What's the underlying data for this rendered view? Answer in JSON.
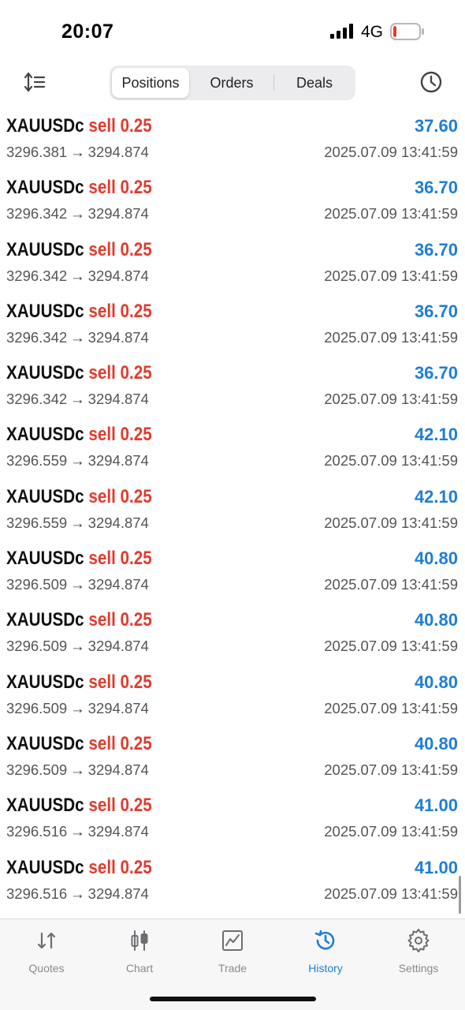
{
  "status_bar": {
    "time": "20:07",
    "network": "4G",
    "signal_icon": "signal-bars-icon",
    "battery_icon": "battery-low-icon",
    "battery_level": 0.12,
    "battery_color": "#e23b2e"
  },
  "header": {
    "sort_icon": "sort-icon",
    "history_icon": "clock-icon",
    "tabs": [
      {
        "label": "Positions",
        "active": true
      },
      {
        "label": "Orders",
        "active": false
      },
      {
        "label": "Deals",
        "active": false
      }
    ]
  },
  "colors": {
    "accent": "#1e7ed6",
    "sell": "#e23b2e",
    "profit": "#1e7ed6"
  },
  "deals": [
    {
      "symbol": "XAUUSDc",
      "side": "sell",
      "volume": "0.25",
      "open_price": "3296.381",
      "close_price": "3294.874",
      "profit": "37.60",
      "time": "2025.07.09 13:41:59"
    },
    {
      "symbol": "XAUUSDc",
      "side": "sell",
      "volume": "0.25",
      "open_price": "3296.342",
      "close_price": "3294.874",
      "profit": "36.70",
      "time": "2025.07.09 13:41:59"
    },
    {
      "symbol": "XAUUSDc",
      "side": "sell",
      "volume": "0.25",
      "open_price": "3296.342",
      "close_price": "3294.874",
      "profit": "36.70",
      "time": "2025.07.09 13:41:59"
    },
    {
      "symbol": "XAUUSDc",
      "side": "sell",
      "volume": "0.25",
      "open_price": "3296.342",
      "close_price": "3294.874",
      "profit": "36.70",
      "time": "2025.07.09 13:41:59"
    },
    {
      "symbol": "XAUUSDc",
      "side": "sell",
      "volume": "0.25",
      "open_price": "3296.342",
      "close_price": "3294.874",
      "profit": "36.70",
      "time": "2025.07.09 13:41:59"
    },
    {
      "symbol": "XAUUSDc",
      "side": "sell",
      "volume": "0.25",
      "open_price": "3296.559",
      "close_price": "3294.874",
      "profit": "42.10",
      "time": "2025.07.09 13:41:59"
    },
    {
      "symbol": "XAUUSDc",
      "side": "sell",
      "volume": "0.25",
      "open_price": "3296.559",
      "close_price": "3294.874",
      "profit": "42.10",
      "time": "2025.07.09 13:41:59"
    },
    {
      "symbol": "XAUUSDc",
      "side": "sell",
      "volume": "0.25",
      "open_price": "3296.509",
      "close_price": "3294.874",
      "profit": "40.80",
      "time": "2025.07.09 13:41:59"
    },
    {
      "symbol": "XAUUSDc",
      "side": "sell",
      "volume": "0.25",
      "open_price": "3296.509",
      "close_price": "3294.874",
      "profit": "40.80",
      "time": "2025.07.09 13:41:59"
    },
    {
      "symbol": "XAUUSDc",
      "side": "sell",
      "volume": "0.25",
      "open_price": "3296.509",
      "close_price": "3294.874",
      "profit": "40.80",
      "time": "2025.07.09 13:41:59"
    },
    {
      "symbol": "XAUUSDc",
      "side": "sell",
      "volume": "0.25",
      "open_price": "3296.509",
      "close_price": "3294.874",
      "profit": "40.80",
      "time": "2025.07.09 13:41:59"
    },
    {
      "symbol": "XAUUSDc",
      "side": "sell",
      "volume": "0.25",
      "open_price": "3296.516",
      "close_price": "3294.874",
      "profit": "41.00",
      "time": "2025.07.09 13:41:59"
    },
    {
      "symbol": "XAUUSDc",
      "side": "sell",
      "volume": "0.25",
      "open_price": "3296.516",
      "close_price": "3294.874",
      "profit": "41.00",
      "time": "2025.07.09 13:41:59"
    }
  ],
  "arrow_glyph": "→",
  "tabbar": {
    "items": [
      {
        "label": "Quotes",
        "icon": "quotes-arrows-icon",
        "active": false
      },
      {
        "label": "Chart",
        "icon": "candlestick-chart-icon",
        "active": false
      },
      {
        "label": "Trade",
        "icon": "trade-chart-icon",
        "active": false
      },
      {
        "label": "History",
        "icon": "history-clock-icon",
        "active": true
      },
      {
        "label": "Settings",
        "icon": "gear-icon",
        "active": false
      }
    ]
  }
}
